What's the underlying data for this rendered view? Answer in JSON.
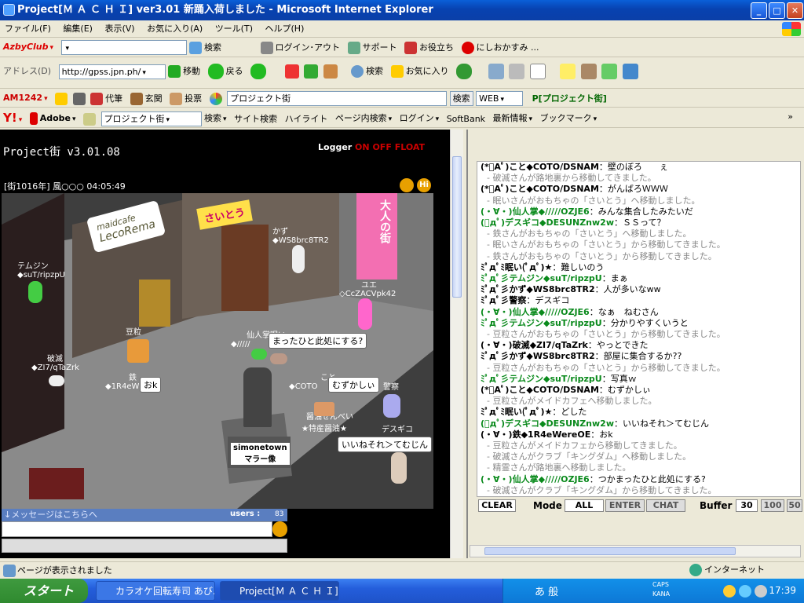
{
  "window": {
    "title": "Project[Ｍ Ａ Ｃ Ｈ Ｉ] ver3.01 新踊入荷しました - Microsoft Internet Explorer",
    "minimize": "_",
    "maximize": "□",
    "close": "✕"
  },
  "menu": [
    "ファイル(F)",
    "編集(E)",
    "表示(V)",
    "お気に入り(A)",
    "ツール(T)",
    "ヘルプ(H)"
  ],
  "azby": {
    "brand": "AzbyClub",
    "search": "検索",
    "login": "ログイン･アウト",
    "support": "サポート",
    "useful": "お役立ち",
    "nishi": "にしおかすみ ..."
  },
  "nav": {
    "back": "戻る",
    "search": "検索",
    "favorites": "お気に入り",
    "address_label": "アドレス(D)",
    "address": "http://gpss.jpn.ph/",
    "go": "移動"
  },
  "am": {
    "brand": "AM1242",
    "daigaku": "代筆",
    "genkan": "玄関",
    "vote": "投票",
    "query": "プロジェクト街",
    "search": "検索",
    "web": "WEB",
    "link": "P[プロジェクト街]"
  },
  "yahoo": {
    "adobe": "Adobe",
    "query": "プロジェクト街",
    "search": "検索",
    "site": "サイト検索",
    "highlight": "ハイライト",
    "pagesearch": "ページ内検索",
    "login": "ログイン",
    "softbank": "SoftBank",
    "news": "最新情報",
    "bookmark": "ブックマーク"
  },
  "game": {
    "title": "Project街  v3.01.08",
    "logger": "Logger",
    "on": "ON",
    "off": "OFF",
    "float": "FLOAT",
    "clock": "[街1016年] 風○○○ 04:05:49",
    "msg_label": "↓メッセージはこちらへ",
    "users_label": "users :",
    "users": "83"
  },
  "scene": {
    "signs": {
      "cafe1": "maidcafe",
      "cafe2": "LecoRema",
      "saito": "さいとう",
      "otona": "大人の街",
      "statue1": "simonetown",
      "statue2": "マラー像"
    },
    "chars": [
      {
        "name": "テムジン",
        "id": "◆suT/ripzpU"
      },
      {
        "name": "かず",
        "id": "◆WS8brc8TR2"
      },
      {
        "name": "ユエ",
        "id": "◇CcZACVpk42"
      },
      {
        "name": "豆粒",
        "id": ""
      },
      {
        "name": "仙人掌",
        "id": "◆/////"
      },
      {
        "name": "眠い",
        "id": ""
      },
      {
        "name": "破滅",
        "id": "◆ZI7/qTaZrk"
      },
      {
        "name": "鉄",
        "id": "◆1R4eW"
      },
      {
        "name": "こと",
        "id": "◆COTO"
      },
      {
        "name": "警察",
        "id": ""
      },
      {
        "name": "醤油せんべい",
        "id": "★特産醤油★"
      },
      {
        "name": "デスギコ",
        "id": ""
      }
    ],
    "bubbles": [
      "まったひと此処にする?",
      "おk",
      "むずかしぃ",
      "いいねそれ＞てむじん"
    ]
  },
  "chat": {
    "lines": [
      {
        "s": "(*ﾟAﾟ)こと◆COTO/DSNAM",
        "t": "：壁のぼろ　　ぇ",
        "k": true
      },
      {
        "t": "破滅さんが路地裏から移動してきました。"
      },
      {
        "s": "(*ﾟAﾟ)こと◆COTO/DSNAM",
        "t": "：がんばろＷＷＷ",
        "k": true
      },
      {
        "t": "眠いさんがおもちゃの「さいとう」へ移動しました。"
      },
      {
        "s": "(・∀・)仙人掌◆/////OZJE6",
        "t": "：みんな集合したみたいだ"
      },
      {
        "s": "(ﾟдﾟ)デスギコ◆DESUNZnw2w",
        "t": "：ＳＳって？"
      },
      {
        "t": "鉄さんがおもちゃの「さいとう」へ移動しました。"
      },
      {
        "t": "眠いさんがおもちゃの「さいとう」から移動してきました。"
      },
      {
        "t": "鉄さんがおもちゃの「さいとう」から移動してきました。"
      },
      {
        "s": "ﾐﾟдﾟﾐ眠い(ﾟдﾟ)★",
        "t": "：難しいのう",
        "k": true
      },
      {
        "s": "ﾐﾟдﾟ彡テムジン◆suT/ripzpU",
        "t": "：まぁ"
      },
      {
        "s": "ﾐﾟдﾟ彡かず◆WS8brc8TR2",
        "t": "：人が多いなww",
        "k": true
      },
      {
        "s": "ﾐﾟдﾟ彡警察",
        "t": "：デスギコ",
        "k": true
      },
      {
        "s": "(・∀・)仙人掌◆/////OZJE6",
        "t": "：なぁ　ねむさん"
      },
      {
        "s": "ﾐﾟдﾟ彡テムジン◆suT/ripzpU",
        "t": "：分かりやすくいうと"
      },
      {
        "t": "豆粒さんがおもちゃの「さいとう」から移動してきました。"
      },
      {
        "s": "(・∀・)破滅◆ZI7/qTaZrk",
        "t": "：やっとできた",
        "k": true
      },
      {
        "s": "ﾐﾟдﾟ彡かず◆WS8brc8TR2",
        "t": "：部屋に集合するか??",
        "k": true
      },
      {
        "t": "豆粒さんがおもちゃの「さいとう」から移動してきました。"
      },
      {
        "s": "ﾐﾟдﾟ彡テムジン◆suT/ripzpU",
        "t": "：写真ｗ"
      },
      {
        "s": "(*ﾟAﾟ)こと◆COTO/DSNAM",
        "t": "：むずかしぃ",
        "k": true
      },
      {
        "t": "豆粒さんがメイドカフェへ移動しました。"
      },
      {
        "s": "ﾐﾟдﾟﾐ眠い(ﾟдﾟ)★",
        "t": "：どした",
        "k": true
      },
      {
        "s": "(ﾟдﾟ)デスギコ◆DESUNZnw2w",
        "t": "：いいねそれ＞てむじん"
      },
      {
        "s": "(・∀・)鉄◆1R4eWereOE",
        "t": "：おk",
        "k": true
      },
      {
        "t": "豆粒さんがメイドカフェから移動してきました。"
      },
      {
        "t": "破滅さんがクラブ「キングダム」へ移動しました。"
      },
      {
        "t": "精霊さんが路地裏へ移動しました。"
      },
      {
        "s": "(・∀・)仙人掌◆/////OZJE6",
        "t": "：つかまったひと此処にする?"
      },
      {
        "t": "破滅さんがクラブ「キングダム」から移動してきました。"
      }
    ],
    "clear": "CLEAR",
    "mode": "Mode",
    "all": "ALL",
    "enter": "ENTER",
    "chatbtn": "CHAT",
    "buffer": "Buffer",
    "b30": "30",
    "b100": "100",
    "b500": "50"
  },
  "status": {
    "text": "ページが表示されました",
    "zone": "インターネット"
  },
  "taskbar": {
    "start": "スタート",
    "t1": "カラオケ回転寿司 あび...",
    "t2": "Project[Ｍ Ａ Ｃ Ｈ Ｉ] v...",
    "ime": "あ 般",
    "caps": "CAPS",
    "kana": "KANA",
    "time": "17:39"
  },
  "colors": {
    "xpblue": "#0a5fd8",
    "speaker": "#0a8a1c",
    "system": "#888888"
  }
}
